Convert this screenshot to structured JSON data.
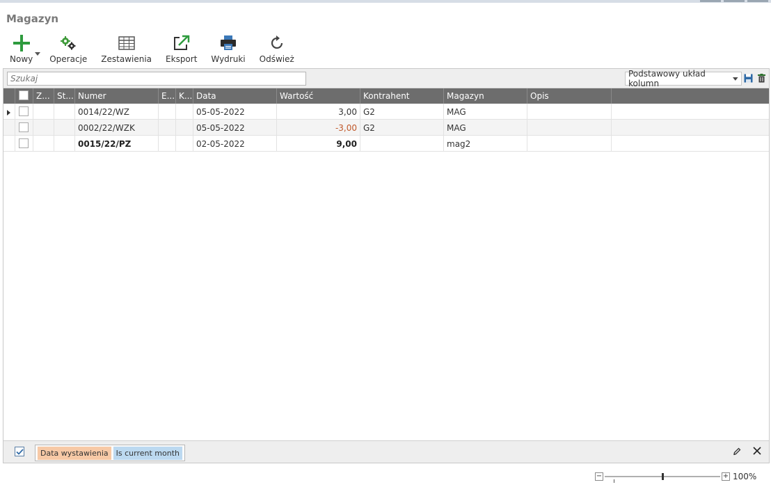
{
  "page": {
    "title": "Magazyn"
  },
  "toolbar": {
    "new_label": "Nowy",
    "operations_label": "Operacje",
    "reports_label": "Zestawienia",
    "export_label": "Eksport",
    "prints_label": "Wydruki",
    "refresh_label": "Odśwież"
  },
  "filter": {
    "search_placeholder": "Szukaj",
    "layout_value": "Podstawowy układ kolumn"
  },
  "columns": {
    "z": "Z...",
    "st": "St...",
    "numer": "Numer",
    "e": "E...",
    "k": "K...",
    "data": "Data",
    "wartosc": "Wartość",
    "kontrahent": "Kontrahent",
    "magazyn": "Magazyn",
    "opis": "Opis"
  },
  "rows": [
    {
      "numer": "0014/22/WZ",
      "data": "05-05-2022",
      "wartosc": "3,00",
      "kontrahent": "G2",
      "magazyn": "MAG",
      "opis": ""
    },
    {
      "numer": "0002/22/WZK",
      "data": "05-05-2022",
      "wartosc": "-3,00",
      "kontrahent": "G2",
      "magazyn": "MAG",
      "opis": ""
    },
    {
      "numer": "0015/22/PZ",
      "data": "02-05-2022",
      "wartosc": "9,00",
      "kontrahent": "",
      "magazyn": "mag2",
      "opis": ""
    }
  ],
  "status": {
    "filter_enabled": true,
    "chip_field": "Data wystawienia",
    "chip_condition": "Is current month"
  },
  "zoom": {
    "label": "100%",
    "level": 1.0
  },
  "colors": {
    "header_bg": "#6d6d6d",
    "new_icon": "#2e9b3e",
    "negative_value": "#c0582a",
    "chip_field_bg": "#f7c9a6",
    "chip_condition_bg": "#bcd9f0"
  },
  "icons": {
    "new": "plus-icon",
    "operations": "gears-icon",
    "reports": "table-icon",
    "export": "export-icon",
    "prints": "printer-icon",
    "refresh": "refresh-icon"
  }
}
